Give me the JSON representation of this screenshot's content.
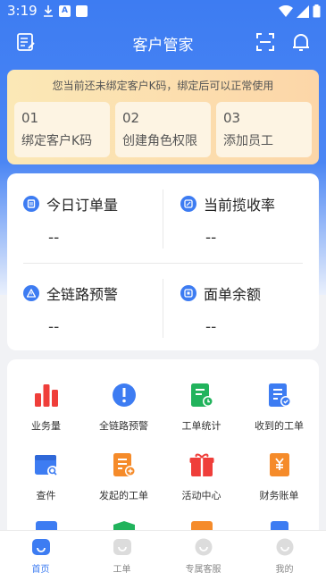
{
  "status_bar": {
    "time": "3:19"
  },
  "header": {
    "title": "客户管家"
  },
  "notice": {
    "message": "您当前还未绑定客户K码，绑定后可以正常使用",
    "steps": [
      {
        "num": "01",
        "label": "绑定客户K码"
      },
      {
        "num": "02",
        "label": "创建角色权限"
      },
      {
        "num": "03",
        "label": "添加员工"
      }
    ]
  },
  "stats": [
    {
      "name": "今日订单量",
      "value": "--"
    },
    {
      "name": "当前揽收率",
      "value": "--"
    },
    {
      "name": "全链路预警",
      "value": "--"
    },
    {
      "name": "面单余额",
      "value": "--"
    }
  ],
  "menu": [
    {
      "label": "业务量",
      "icon": "bar-chart-icon",
      "color": "#ef3e3a"
    },
    {
      "label": "全链路预警",
      "icon": "alert-shield-icon",
      "color": "#3d7cf2"
    },
    {
      "label": "工单统计",
      "icon": "ticket-stats-icon",
      "color": "#21b35c"
    },
    {
      "label": "收到的工单",
      "icon": "received-ticket-icon",
      "color": "#3d7cf2"
    },
    {
      "label": "查件",
      "icon": "search-parcel-icon",
      "color": "#3d7cf2"
    },
    {
      "label": "发起的工单",
      "icon": "create-ticket-icon",
      "color": "#f58b2a"
    },
    {
      "label": "活动中心",
      "icon": "gift-icon",
      "color": "#ef3e3a"
    },
    {
      "label": "财务账单",
      "icon": "finance-bill-icon",
      "color": "#f58b2a"
    }
  ],
  "tabs": [
    {
      "label": "首页",
      "active": true
    },
    {
      "label": "工单",
      "active": false
    },
    {
      "label": "专属客服",
      "active": false
    },
    {
      "label": "我的",
      "active": false
    }
  ],
  "colors": {
    "primary": "#3d7cf2",
    "notice_bg": "#fbe8b6"
  }
}
